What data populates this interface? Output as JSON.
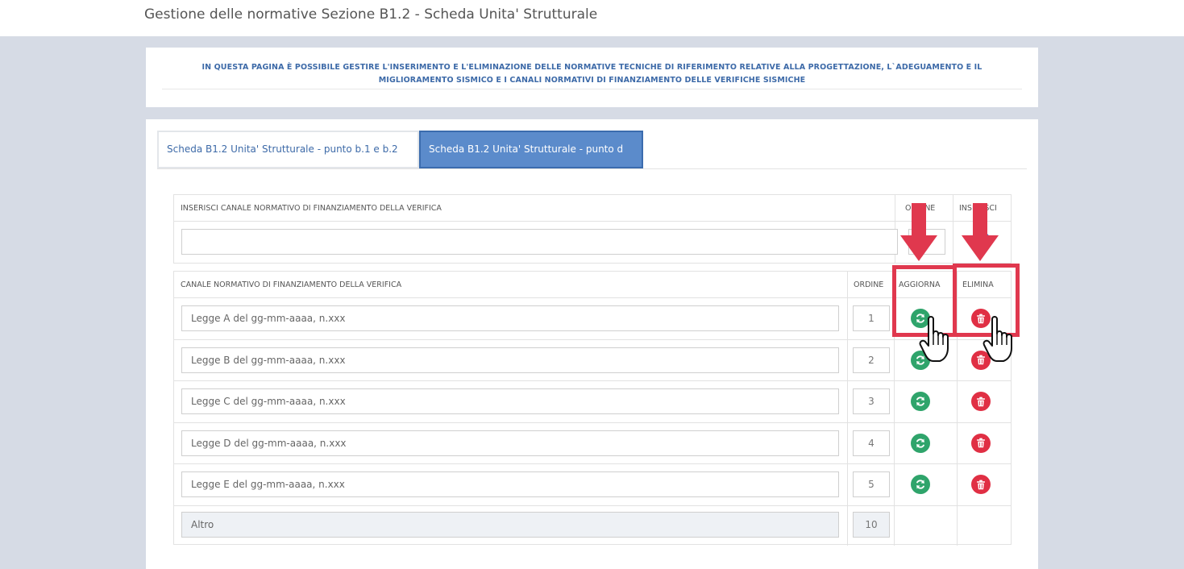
{
  "page": {
    "title": "Gestione delle normative Sezione B1.2 - Scheda Unita' Strutturale"
  },
  "info": {
    "line1": "IN QUESTA PAGINA È POSSIBILE GESTIRE L'INSERIMENTO E L'ELIMINAZIONE DELLE NORMATIVE TECNICHE DI RIFERIMENTO RELATIVE ALLA PROGETTAZIONE, L`ADEGUAMENTO E IL",
    "line2": "MIGLIORAMENTO SISMICO E I CANALI NORMATIVI DI FINANZIAMENTO DELLE VERIFICHE SISMICHE"
  },
  "tabs": [
    {
      "label": "Scheda B1.2 Unita' Strutturale - punto b.1 e b.2",
      "active": false
    },
    {
      "label": "Scheda B1.2 Unita' Strutturale - punto d",
      "active": true
    }
  ],
  "insert_table": {
    "col_canale": "INSERISCI CANALE NORMATIVO DI FINANZIAMENTO DELLA VERIFICA",
    "col_ordine": "ORDINE",
    "col_inserisci": "INSERISCI",
    "canale_value": "",
    "ordine_value": ""
  },
  "list_table": {
    "col_canale": "CANALE NORMATIVO DI FINANZIAMENTO DELLA VERIFICA",
    "col_ordine": "ORDINE",
    "col_aggiorna": "AGGIORNA",
    "col_elimina": "ELIMINA",
    "rows": [
      {
        "canale": "Legge A del gg-mm-aaaa, n.xxx",
        "ordine": "1"
      },
      {
        "canale": "Legge B del gg-mm-aaaa, n.xxx",
        "ordine": "2"
      },
      {
        "canale": "Legge C del gg-mm-aaaa, n.xxx",
        "ordine": "3"
      },
      {
        "canale": "Legge D del gg-mm-aaaa, n.xxx",
        "ordine": "4"
      },
      {
        "canale": "Legge E del gg-mm-aaaa, n.xxx",
        "ordine": "5"
      }
    ],
    "altro": {
      "canale": "Altro",
      "ordine": "10"
    }
  },
  "icons": {
    "update": "refresh-icon",
    "delete": "trash-icon",
    "insert": "plus-icon",
    "pointer": "hand-cursor-icon",
    "annotation": "arrow-down-icon"
  },
  "colors": {
    "accent_blue": "#3d6aa8",
    "active_tab": "#5b8bcb",
    "update_green": "#2fa46b",
    "delete_red": "#e02f44",
    "annotation_red": "#e0384e",
    "background": "#d6dbe5"
  }
}
